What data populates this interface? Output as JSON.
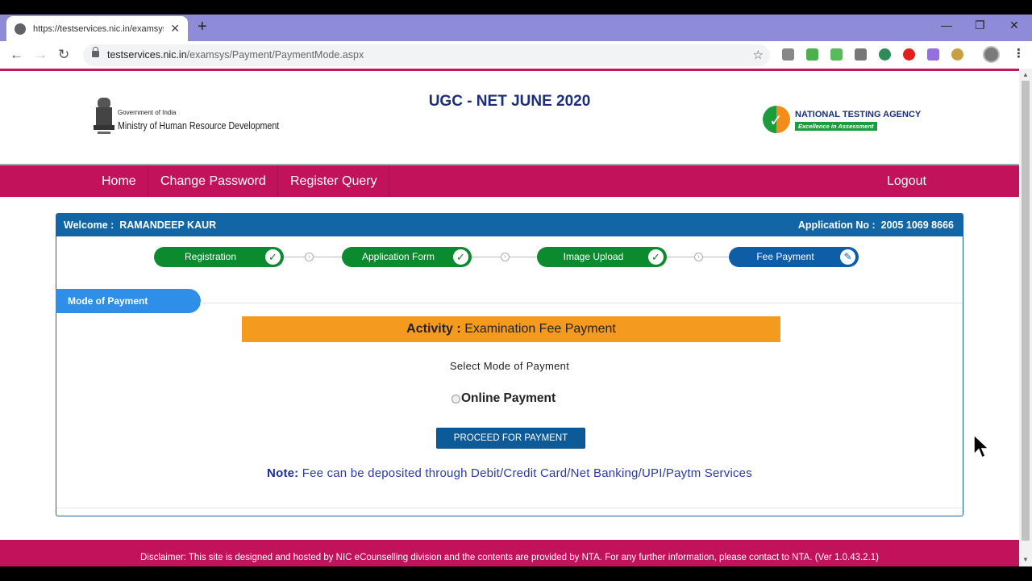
{
  "browser": {
    "tab_title": "https://testservices.nic.in/examsys",
    "url_host": "testservices.nic.in",
    "url_path": "/examsys/Payment/PaymentMode.aspx",
    "new_tab": "+",
    "minimize": "—",
    "restore": "❐",
    "close": "✕",
    "back": "←",
    "forward": "→",
    "reload": "↻",
    "bookmark_star": "☆",
    "menu": "⋮"
  },
  "header": {
    "gov_label": "Government of India",
    "ministry": "Ministry of Human Resource Development",
    "title": "UGC - NET JUNE 2020",
    "agency_name": "NATIONAL TESTING AGENCY",
    "agency_tagline": "Excellence in Assessment"
  },
  "nav": {
    "home": "Home",
    "change_password": "Change Password",
    "register_query": "Register Query",
    "logout": "Logout"
  },
  "panel": {
    "welcome_label": "Welcome :",
    "candidate_name": "RAMANDEEP KAUR",
    "appno_label": "Application No :",
    "appno_value": "2005 1069 8666"
  },
  "steps": [
    {
      "label": "Registration",
      "status": "done",
      "mark": "✓"
    },
    {
      "label": "Application Form",
      "status": "done",
      "mark": "✓"
    },
    {
      "label": "Image Upload",
      "status": "done",
      "mark": "✓"
    },
    {
      "label": "Fee Payment",
      "status": "current",
      "mark": "✎"
    }
  ],
  "payment": {
    "section_title": "Mode of Payment",
    "activity_label": "Activity :",
    "activity_value": "Examination Fee Payment",
    "select_prompt": "Select Mode of Payment",
    "option_online": "Online Payment",
    "proceed_button": "PROCEED FOR PAYMENT",
    "note_label": "Note:",
    "note_text": "Fee can be deposited through Debit/Credit Card/Net Banking/UPI/Paytm Services"
  },
  "footer": {
    "disclaimer": "Disclaimer: This site is designed and hosted by NIC eCounselling division and the contents are provided by NTA. For any further information, please contact to NTA. (Ver 1.0.43.2.1)"
  },
  "colors": {
    "brand_pink": "#c1125b",
    "panel_blue": "#1366a6",
    "step_green": "#0c8a2e",
    "activity_orange": "#f39a1f"
  }
}
